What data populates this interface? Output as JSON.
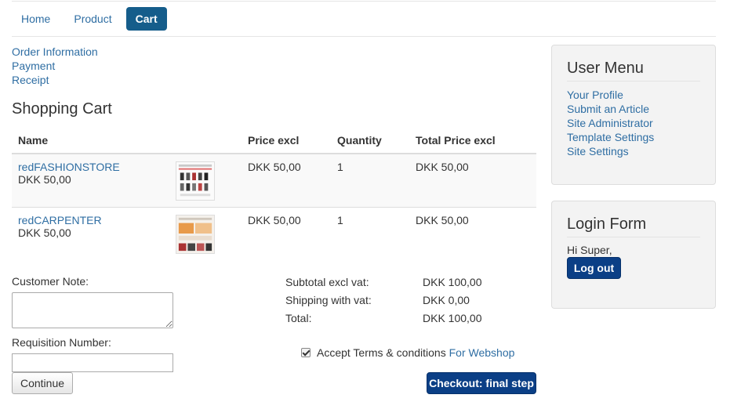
{
  "nav": {
    "items": [
      {
        "label": "Home",
        "active": false
      },
      {
        "label": "Product",
        "active": false
      },
      {
        "label": "Cart",
        "active": true
      }
    ]
  },
  "steps": [
    "Order Information",
    "Payment",
    "Receipt"
  ],
  "cart": {
    "title": "Shopping Cart",
    "headers": {
      "name": "Name",
      "price": "Price excl",
      "quantity": "Quantity",
      "total": "Total Price excl"
    },
    "rows": [
      {
        "name": "redFASHIONSTORE",
        "sub_price": "DKK 50,00",
        "price": "DKK 50,00",
        "quantity": "1",
        "total": "DKK 50,00"
      },
      {
        "name": "redCARPENTER",
        "sub_price": "DKK 50,00",
        "price": "DKK 50,00",
        "quantity": "1",
        "total": "DKK 50,00"
      }
    ]
  },
  "form": {
    "customer_note_label": "Customer Note:",
    "customer_note_value": "",
    "requisition_label": "Requisition Number:",
    "requisition_value": "",
    "continue_label": "Continue"
  },
  "totals": {
    "subtotal_label": "Subtotal excl vat:",
    "subtotal_value": "DKK 100,00",
    "shipping_label": "Shipping with vat:",
    "shipping_value": "DKK 0,00",
    "total_label": "Total:",
    "total_value": "DKK 100,00"
  },
  "terms": {
    "checked": true,
    "label": "Accept Terms & conditions",
    "link": "For Webshop"
  },
  "checkout_label": "Checkout: final step",
  "user_menu": {
    "title": "User Menu",
    "items": [
      "Your Profile",
      "Submit an Article",
      "Site Administrator",
      "Template Settings",
      "Site Settings"
    ]
  },
  "login": {
    "title": "Login Form",
    "greeting": "Hi Super,",
    "logout_label": "Log out"
  },
  "colors": {
    "link": "#2f6ea3",
    "primary_button": "#0b3f86",
    "active_tab": "#155d8b"
  }
}
